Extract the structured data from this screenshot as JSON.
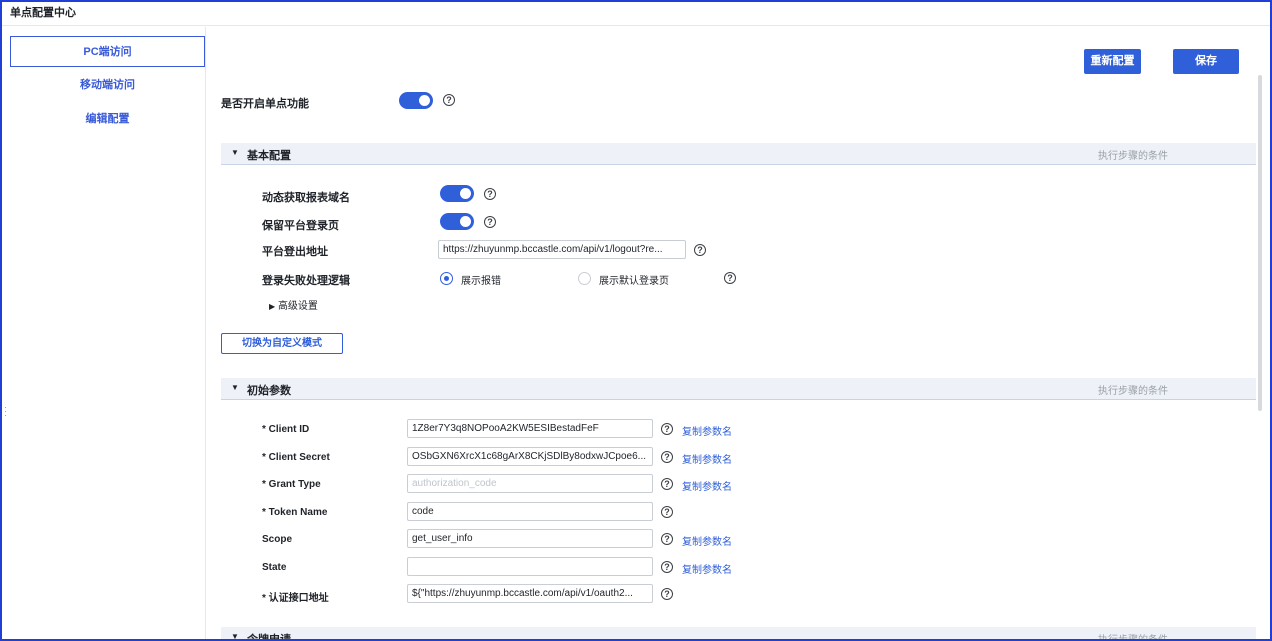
{
  "app": {
    "title": "单点配置中心"
  },
  "sidebar": {
    "items": [
      {
        "label": "PC端访问",
        "active": true
      },
      {
        "label": "移动端访问",
        "active": false
      },
      {
        "label": "编辑配置",
        "active": false
      }
    ]
  },
  "toolbar": {
    "reconfigure_label": "重新配置",
    "save_label": "保存"
  },
  "sso": {
    "enable_label": "是否开启单点功能",
    "enabled": true
  },
  "basic_section": {
    "title": "基本配置",
    "right_text": "执行步骤的条件",
    "dynamic_domain": {
      "label": "动态获取报表域名",
      "enabled": true
    },
    "keep_login_page": {
      "label": "保留平台登录页",
      "enabled": true
    },
    "logout_url": {
      "label": "平台登出地址",
      "value": "https://zhuyunmp.bccastle.com/api/v1/logout?re..."
    },
    "login_fail": {
      "label": "登录失败处理逻辑",
      "options": [
        {
          "label": "展示报错",
          "selected": true
        },
        {
          "label": "展示默认登录页",
          "selected": false
        }
      ]
    },
    "advanced_label": "高级设置",
    "switch_mode_label": "切换为自定义模式"
  },
  "init_section": {
    "title": "初始参数",
    "right_text": "执行步骤的条件",
    "copy_label": "复制参数名",
    "params": [
      {
        "label": "* Client ID",
        "value": "1Z8er7Y3q8NOPooA2KW5ESIBestadFeF",
        "placeholder": "",
        "copy": true
      },
      {
        "label": "* Client Secret",
        "value": "OSbGXN6XrcX1c68gArX8CKjSDlBy8odxwJCpoe6...",
        "placeholder": "",
        "copy": true
      },
      {
        "label": "* Grant Type",
        "value": "",
        "placeholder": "authorization_code",
        "copy": true
      },
      {
        "label": "* Token Name",
        "value": "code",
        "placeholder": "",
        "copy": false
      },
      {
        "label": "Scope",
        "value": "get_user_info",
        "placeholder": "",
        "copy": true
      },
      {
        "label": "State",
        "value": "",
        "placeholder": "",
        "copy": true
      },
      {
        "label": "* 认证接口地址",
        "value": "${\"https://zhuyunmp.bccastle.com/api/v1/oauth2...",
        "placeholder": "",
        "copy": false
      }
    ]
  },
  "next_section": {
    "title": "令牌申请",
    "right_text": "执行步骤的条件"
  },
  "colors": {
    "accent": "#2f5fd9",
    "frame": "#1f3fd6",
    "section_bg": "#eef2f8"
  }
}
